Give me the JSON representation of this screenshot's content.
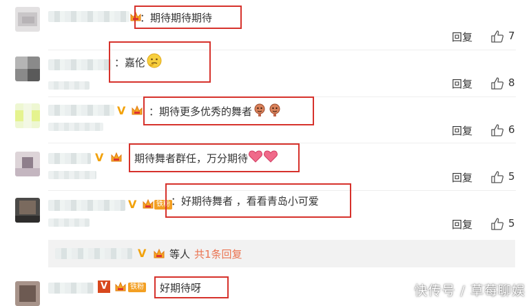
{
  "reply_label": "回复",
  "comments": [
    {
      "text": "：期待期待期待",
      "likes": "7"
    },
    {
      "text": "：嘉伦",
      "likes": "8"
    },
    {
      "text": "：期待更多优秀的舞者",
      "likes": "6"
    },
    {
      "text": "期待舞者群任，万分期待",
      "likes": "5"
    },
    {
      "text": "：好期待舞者 ，看看青岛小可爱",
      "likes": "5",
      "fans_badge": "铁粉"
    },
    {
      "text": "好期待呀",
      "fans_badge": "铁粉"
    }
  ],
  "reply_summary": {
    "prefix": "等人",
    "link": "共1条回复"
  },
  "vip_mark": "V",
  "watermark": "快传号 / 草莓聊娱",
  "colors": {
    "highlight_box": "#d6312b",
    "vip": "#f2a20c",
    "link": "#eb7350"
  }
}
